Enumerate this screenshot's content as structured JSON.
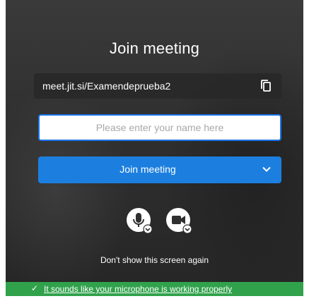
{
  "prejoin": {
    "title": "Join meeting",
    "meeting_url": "meet.jit.si/Examendeprueba2",
    "name_input": {
      "placeholder": "Please enter your name here",
      "value": ""
    },
    "join_button": {
      "label": "Join meeting"
    },
    "dont_show_label": "Don't show this screen again"
  },
  "status": {
    "icon": "✓",
    "message": "It sounds like your microphone is working properly"
  },
  "icons": {
    "copy": "copy-icon",
    "chevron": "chevron-down-icon",
    "mic": "microphone-icon",
    "camera": "camera-icon"
  },
  "colors": {
    "accent": "#1c7fe0",
    "success": "#31a24c",
    "background": "#2f2f2f"
  }
}
